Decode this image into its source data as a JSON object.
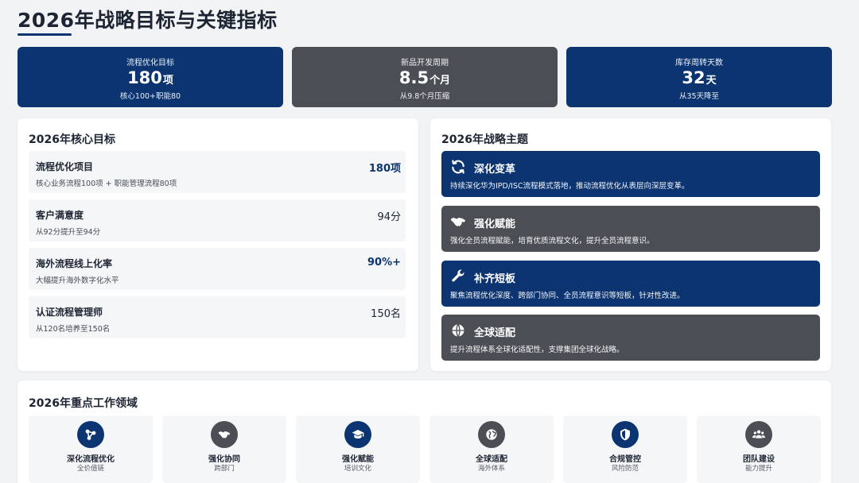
{
  "header": {
    "title": "2026年战略目标与关键指标"
  },
  "kpis": [
    {
      "label": "流程优化目标",
      "value": "180",
      "unit": "项",
      "sub": "核心100+职能80"
    },
    {
      "label": "新品开发周期",
      "value": "8.5",
      "unit": "个月",
      "sub": "从9.8个月压缩"
    },
    {
      "label": "库存周转天数",
      "value": "32",
      "unit": "天",
      "sub": "从35天降至"
    }
  ],
  "goals": {
    "title": "2026年核心目标",
    "items": [
      {
        "name": "流程优化项目",
        "value": "180项",
        "desc": "核心业务流程100项 + 职能管理流程80项"
      },
      {
        "name": "客户满意度",
        "value": "94分",
        "desc": "从92分提升至94分"
      },
      {
        "name": "海外流程线上化率",
        "value": "90%+",
        "desc": "大幅提升海外数字化水平"
      },
      {
        "name": "认证流程管理师",
        "value": "150名",
        "desc": "从120名培养至150名"
      }
    ]
  },
  "themes": {
    "title": "2026年战略主题",
    "items": [
      {
        "name": "深化变革",
        "icon": "sync-icon",
        "desc": "持续深化华为IPD/ISC流程模式落地，推动流程优化从表层向深层变革。"
      },
      {
        "name": "强化赋能",
        "icon": "handshake-icon",
        "desc": "强化全员流程赋能，培育优质流程文化，提升全员流程意识。"
      },
      {
        "name": "补齐短板",
        "icon": "wrench-icon",
        "desc": "聚焦流程优化深度、跨部门协同、全员流程意识等短板，针对性改进。"
      },
      {
        "name": "全球适配",
        "icon": "globe-icon",
        "desc": "提升流程体系全球化适配性，支撑集团全球化战略。"
      }
    ]
  },
  "areas": {
    "title": "2026年重点工作领域",
    "items": [
      {
        "name": "深化流程优化",
        "sub": "全价值链",
        "icon": "network-icon"
      },
      {
        "name": "强化协同",
        "sub": "跨部门",
        "icon": "handshake-icon"
      },
      {
        "name": "强化赋能",
        "sub": "培训文化",
        "icon": "graduation-cap-icon"
      },
      {
        "name": "全球适配",
        "sub": "海外体系",
        "icon": "globe-icon"
      },
      {
        "name": "合规管控",
        "sub": "风险防范",
        "icon": "shield-icon"
      },
      {
        "name": "团队建设",
        "sub": "能力提升",
        "icon": "team-icon"
      }
    ]
  },
  "colors": {
    "navy": "#0b3470",
    "gray": "#4b4f55",
    "background": "#f2f3f5"
  }
}
